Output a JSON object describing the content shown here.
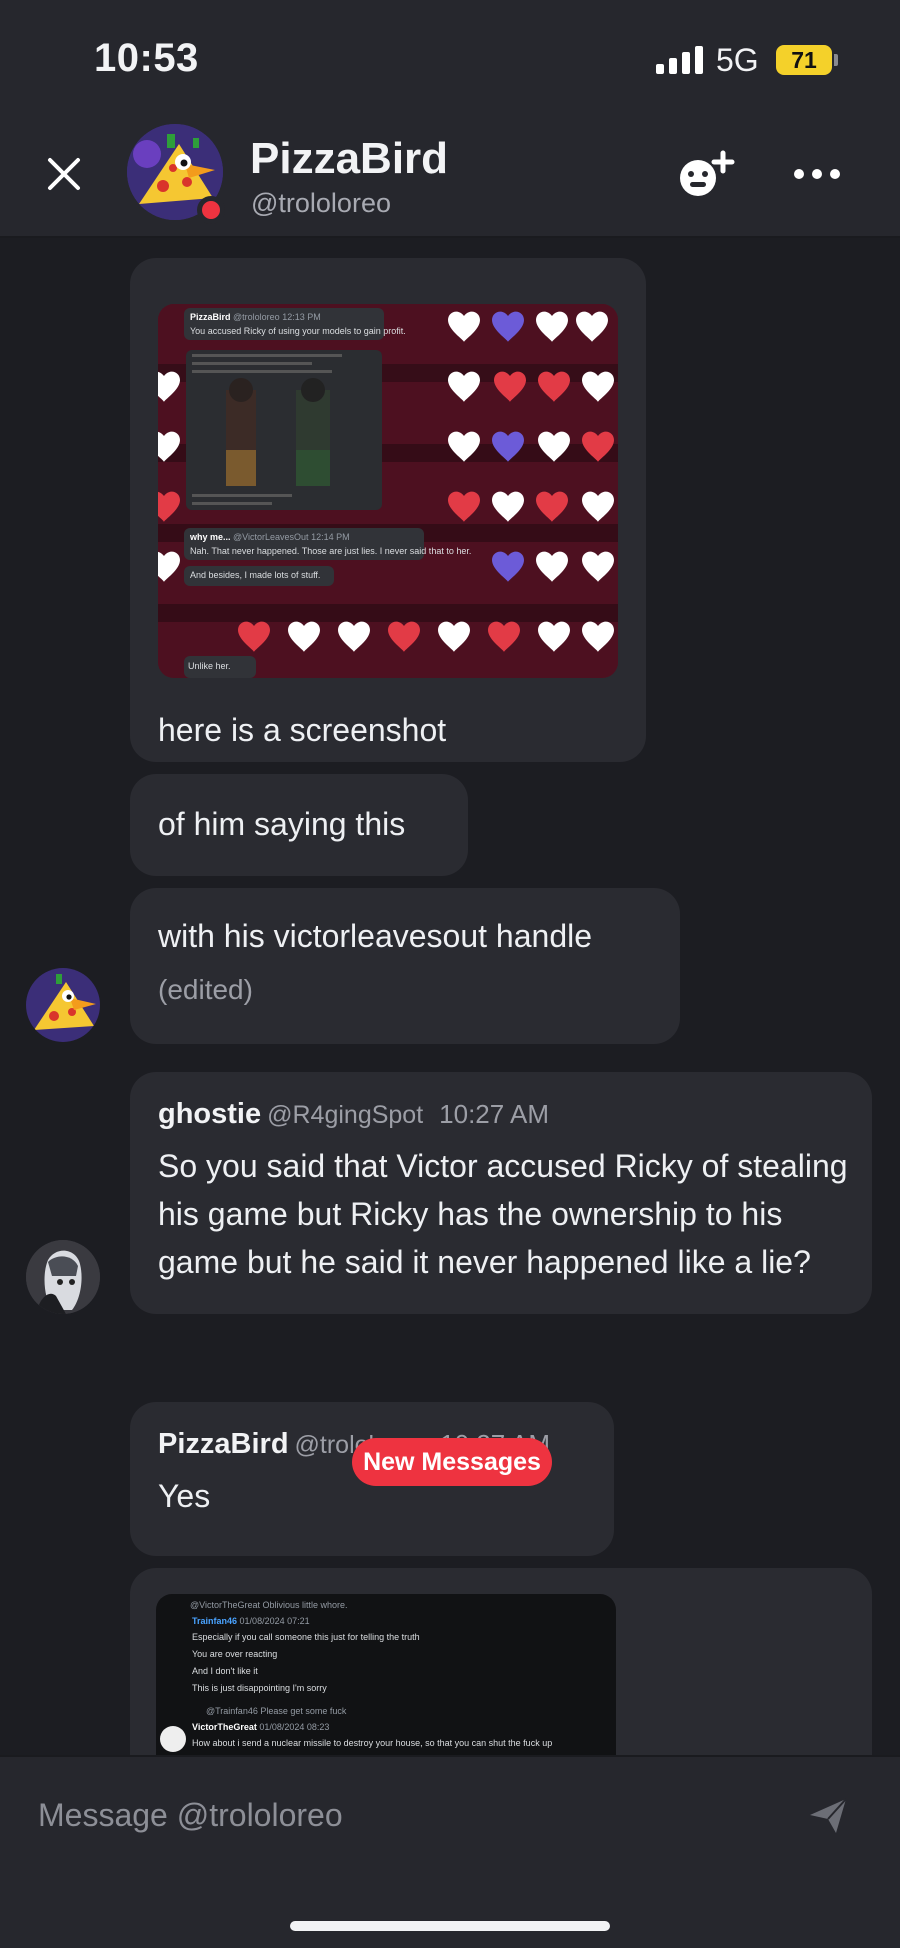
{
  "status_bar": {
    "time": "10:53",
    "network": "5G",
    "battery": "71"
  },
  "header": {
    "name": "PizzaBird",
    "handle": "@trololoreo"
  },
  "screenshot1": {
    "top_name": "PizzaBird",
    "top_handle": "@trololoreo",
    "top_time": "12:13 PM",
    "top_text": "You accused Ricky of using your models to gain profit.",
    "reply_name": "why me...",
    "reply_handle": "@VictorLeavesOut",
    "reply_time": "12:14 PM",
    "reply_text": "Nah. That never happened. Those are just lies. I never said that to her.",
    "line2": "And besides, I made lots of stuff.",
    "line3": "Unlike her."
  },
  "messages": [
    {
      "text": "here is a screenshot"
    },
    {
      "text": "of him saying this"
    },
    {
      "text": "with his victorleavesout handle",
      "edited": "(edited)"
    },
    {
      "name": "ghostie",
      "handle": "@R4gingSpot",
      "time": "10:27 AM",
      "text": "So you said that Victor accused Ricky of stealing his game but Ricky has the ownership to his game but he said it never happened like a lie?"
    },
    {
      "name": "PizzaBird",
      "handle": "@trololoreo",
      "time": "10:27 AM",
      "text": "Yes"
    }
  ],
  "screenshot2": {
    "l1": "@VictorTheGreat Oblivious little whore.",
    "l2_name": "Trainfan46",
    "l2_time": "01/08/2024 07:21",
    "l3": "Especially if you call someone this just for telling the truth",
    "l4": "You are over reacting",
    "l5": "And I don't like it",
    "l6": "This is just disappointing I'm sorry",
    "l7": "@Trainfan46 Please get some fuck",
    "l8_name": "VictorTheGreat",
    "l8_time": "01/08/2024 08:23",
    "l9": "How about i send a nuclear missile to destroy your house, so that you can shut the fuck up"
  },
  "new_messages_label": "New Messages",
  "composer": {
    "placeholder": "Message @trololoreo"
  },
  "colors": {
    "accent_red": "#ee3340",
    "battery": "#f4d12a",
    "bubble": "#2a2b31",
    "background": "#1c1d22"
  }
}
